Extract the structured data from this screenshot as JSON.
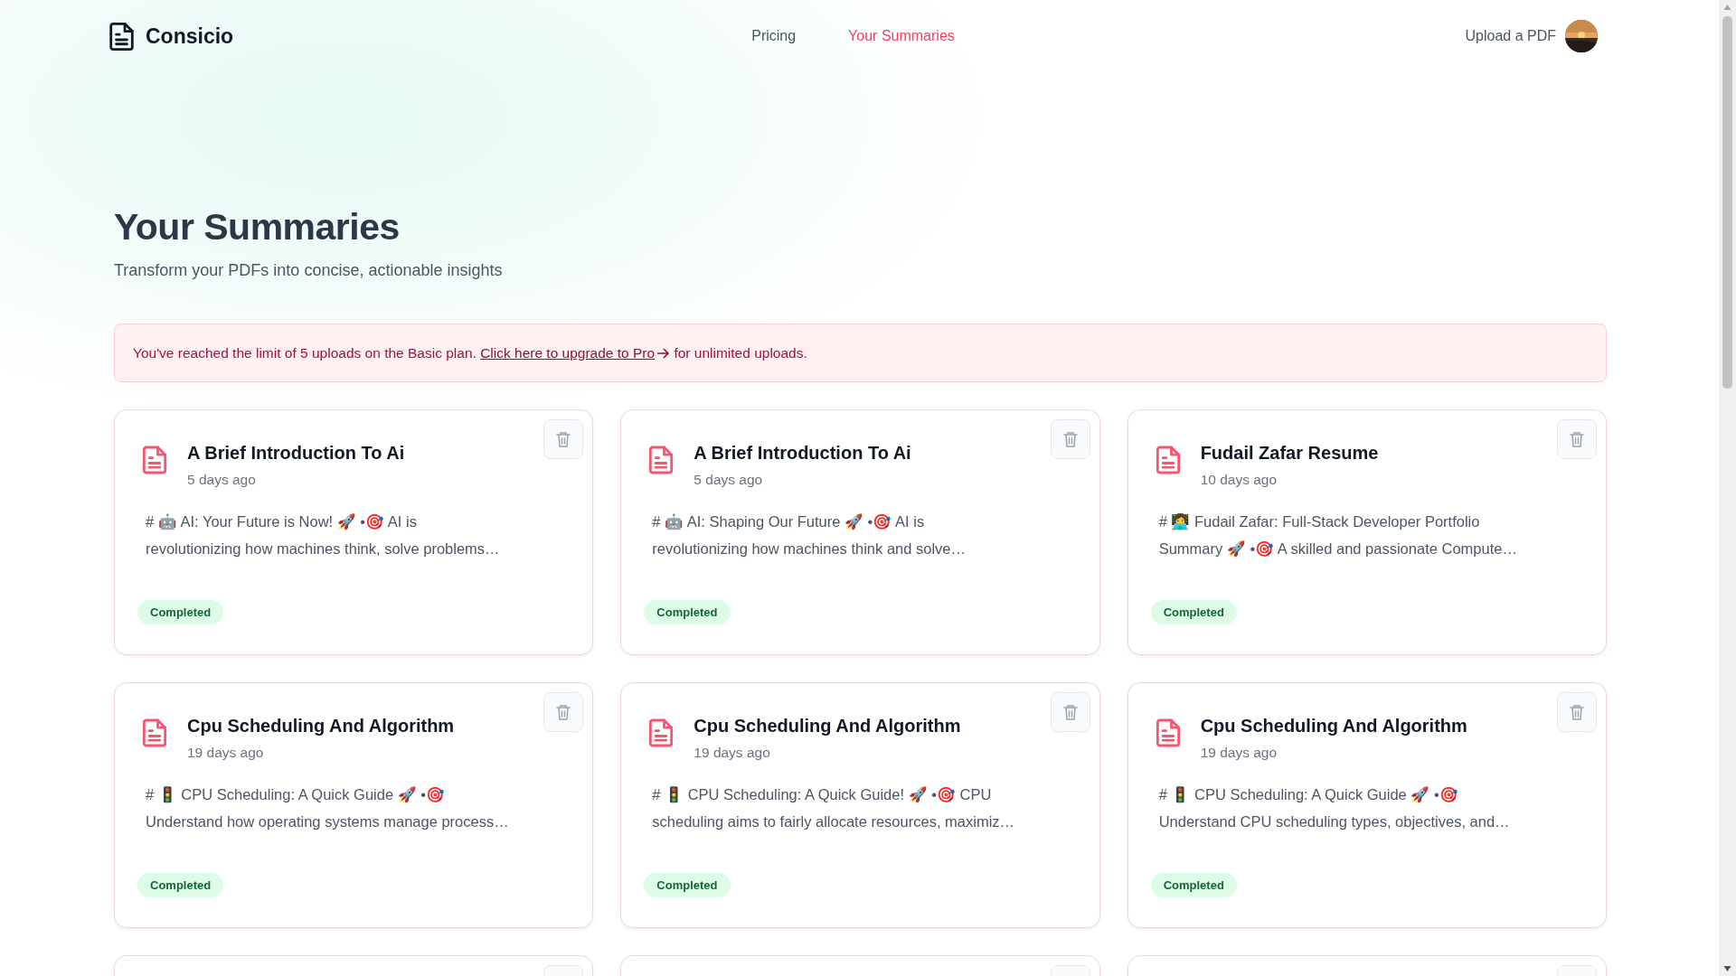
{
  "header": {
    "brand": "Consicio",
    "nav": [
      {
        "label": "Pricing",
        "selected": false
      },
      {
        "label": "Your Summaries",
        "selected": true
      }
    ],
    "upload_link": "Upload a PDF"
  },
  "page": {
    "title": "Your Summaries",
    "subtitle": "Transform your PDFs into concise, actionable insights"
  },
  "alert": {
    "text_before": "You've reached the limit of 5 uploads on the Basic plan.",
    "link": "Click here to upgrade to Pro",
    "text_after": "for unlimited uploads."
  },
  "summaries": [
    {
      "kind": "summary",
      "title": "A Brief Introduction To Ai",
      "age": "5 days ago",
      "preview_lines": [
        "# 🤖 AI: Your Future is Now! 🚀 •🎯 AI is",
        "revolutionizing how machines think, solve problems…"
      ],
      "status": "Completed"
    },
    {
      "kind": "summary",
      "title": "A Brief Introduction To Ai",
      "age": "5 days ago",
      "preview_lines": [
        "# 🤖 AI: Shaping Our Future 🚀 •🎯 AI is",
        "revolutionizing how machines think and solve…"
      ],
      "status": "Completed"
    },
    {
      "kind": "summary",
      "title": "Fudail Zafar Resume",
      "age": "10 days ago",
      "preview_lines": [
        "# 👩‍💻 Fudail Zafar: Full-Stack Developer Portfolio",
        "Summary 🚀 •🎯 A skilled and passionate Compute…"
      ],
      "status": "Completed"
    },
    {
      "kind": "summary",
      "title": "Cpu Scheduling And Algorithm",
      "age": "19 days ago",
      "preview_lines": [
        "# 🚦 CPU Scheduling: A Quick Guide 🚀 •🎯",
        "Understand how operating systems manage process…"
      ],
      "status": "Completed"
    },
    {
      "kind": "summary",
      "title": "Cpu Scheduling And Algorithm",
      "age": "19 days ago",
      "preview_lines": [
        "# 🚦 CPU Scheduling: A Quick Guide! 🚀 •🎯 CPU",
        "scheduling aims to fairly allocate resources, maximiz…"
      ],
      "status": "Completed"
    },
    {
      "kind": "summary",
      "title": "Cpu Scheduling And Algorithm",
      "age": "19 days ago",
      "preview_lines": [
        "# 🚦 CPU Scheduling: A Quick Guide 🚀 •🎯",
        "Understand CPU scheduling types, objectives, and…"
      ],
      "status": "Completed"
    },
    {
      "kind": "partial"
    },
    {
      "kind": "partial"
    },
    {
      "kind": "partial"
    }
  ]
}
